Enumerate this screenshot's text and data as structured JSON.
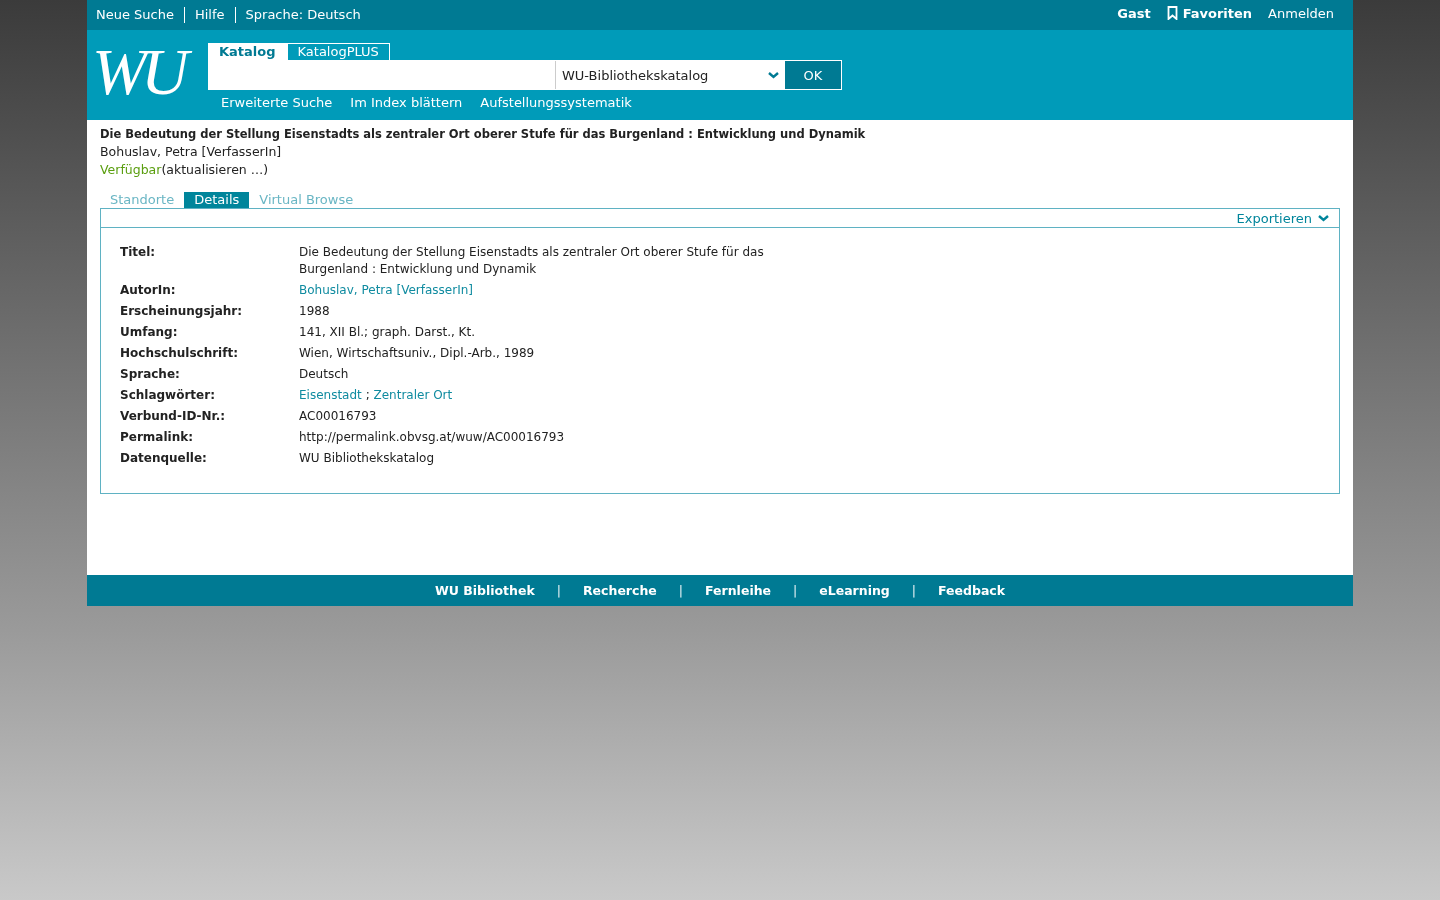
{
  "top_bar": {
    "links": [
      "Neue Suche",
      "Hilfe",
      "Sprache: Deutsch"
    ],
    "user": "Gast",
    "favorites": "Favoriten",
    "login": "Anmelden"
  },
  "header": {
    "logo": "WU",
    "tabs": [
      {
        "label": "Katalog",
        "selected": true
      },
      {
        "label": "KatalogPLUS",
        "selected": false
      }
    ],
    "scope": "WU-Bibliothekskatalog",
    "submit": "OK",
    "links": [
      "Erweiterte Suche",
      "Im Index blättern",
      "Aufstellungssystematik"
    ]
  },
  "record": {
    "title": "Die Bedeutung der Stellung Eisenstadts als zentraler Ort oberer Stufe für das Burgenland : Entwicklung und Dynamik",
    "author": "Bohuslav, Petra [VerfasserIn]",
    "status": "Verfügbar",
    "refresh": "(aktualisieren …)"
  },
  "tabs": [
    {
      "label": "Standorte",
      "selected": false
    },
    {
      "label": "Details",
      "selected": true
    },
    {
      "label": "Virtual Browse",
      "selected": false
    }
  ],
  "export": "Exportieren",
  "details": [
    {
      "label": "Titel:",
      "parts": [
        {
          "kind": "text",
          "text": "Die Bedeutung der Stellung Eisenstadts als zentraler Ort oberer Stufe für das Burgenland : Entwicklung und Dynamik"
        }
      ]
    },
    {
      "label": "AutorIn:",
      "parts": [
        {
          "kind": "link",
          "text": "Bohuslav, Petra [VerfasserIn]"
        }
      ]
    },
    {
      "label": "Erscheinungsjahr:",
      "parts": [
        {
          "kind": "text",
          "text": "1988"
        }
      ]
    },
    {
      "label": "Umfang:",
      "parts": [
        {
          "kind": "text",
          "text": "141, XII Bl.; graph. Darst., Kt."
        }
      ]
    },
    {
      "label": "Hochschulschrift:",
      "parts": [
        {
          "kind": "text",
          "text": "Wien, Wirtschaftsuniv., Dipl.-Arb., 1989"
        }
      ]
    },
    {
      "label": "Sprache:",
      "parts": [
        {
          "kind": "text",
          "text": "Deutsch"
        }
      ]
    },
    {
      "label": "Schlagwörter:",
      "parts": [
        {
          "kind": "link",
          "text": "Eisenstadt"
        },
        {
          "kind": "text",
          "text": ";"
        },
        {
          "kind": "link",
          "text": "Zentraler Ort"
        }
      ]
    },
    {
      "label": "Verbund-ID-Nr.:",
      "parts": [
        {
          "kind": "text",
          "text": "AC00016793"
        }
      ]
    },
    {
      "label": "Permalink:",
      "parts": [
        {
          "kind": "text",
          "text": "http://permalink.obvsg.at/wuw/AC00016793"
        }
      ]
    },
    {
      "label": "Datenquelle:",
      "parts": [
        {
          "kind": "text",
          "text": "WU Bibliothekskatalog"
        }
      ]
    }
  ],
  "footer": [
    {
      "kind": "link",
      "text": "WU Bibliothek"
    },
    {
      "kind": "separator",
      "text": "|"
    },
    {
      "kind": "link",
      "text": "Recherche"
    },
    {
      "kind": "separator",
      "text": "|"
    },
    {
      "kind": "link",
      "text": "Fernleihe"
    },
    {
      "kind": "separator",
      "text": "|"
    },
    {
      "kind": "link",
      "text": "eLearning"
    },
    {
      "kind": "separator",
      "text": "|"
    },
    {
      "kind": "link",
      "text": "Feedback"
    }
  ]
}
